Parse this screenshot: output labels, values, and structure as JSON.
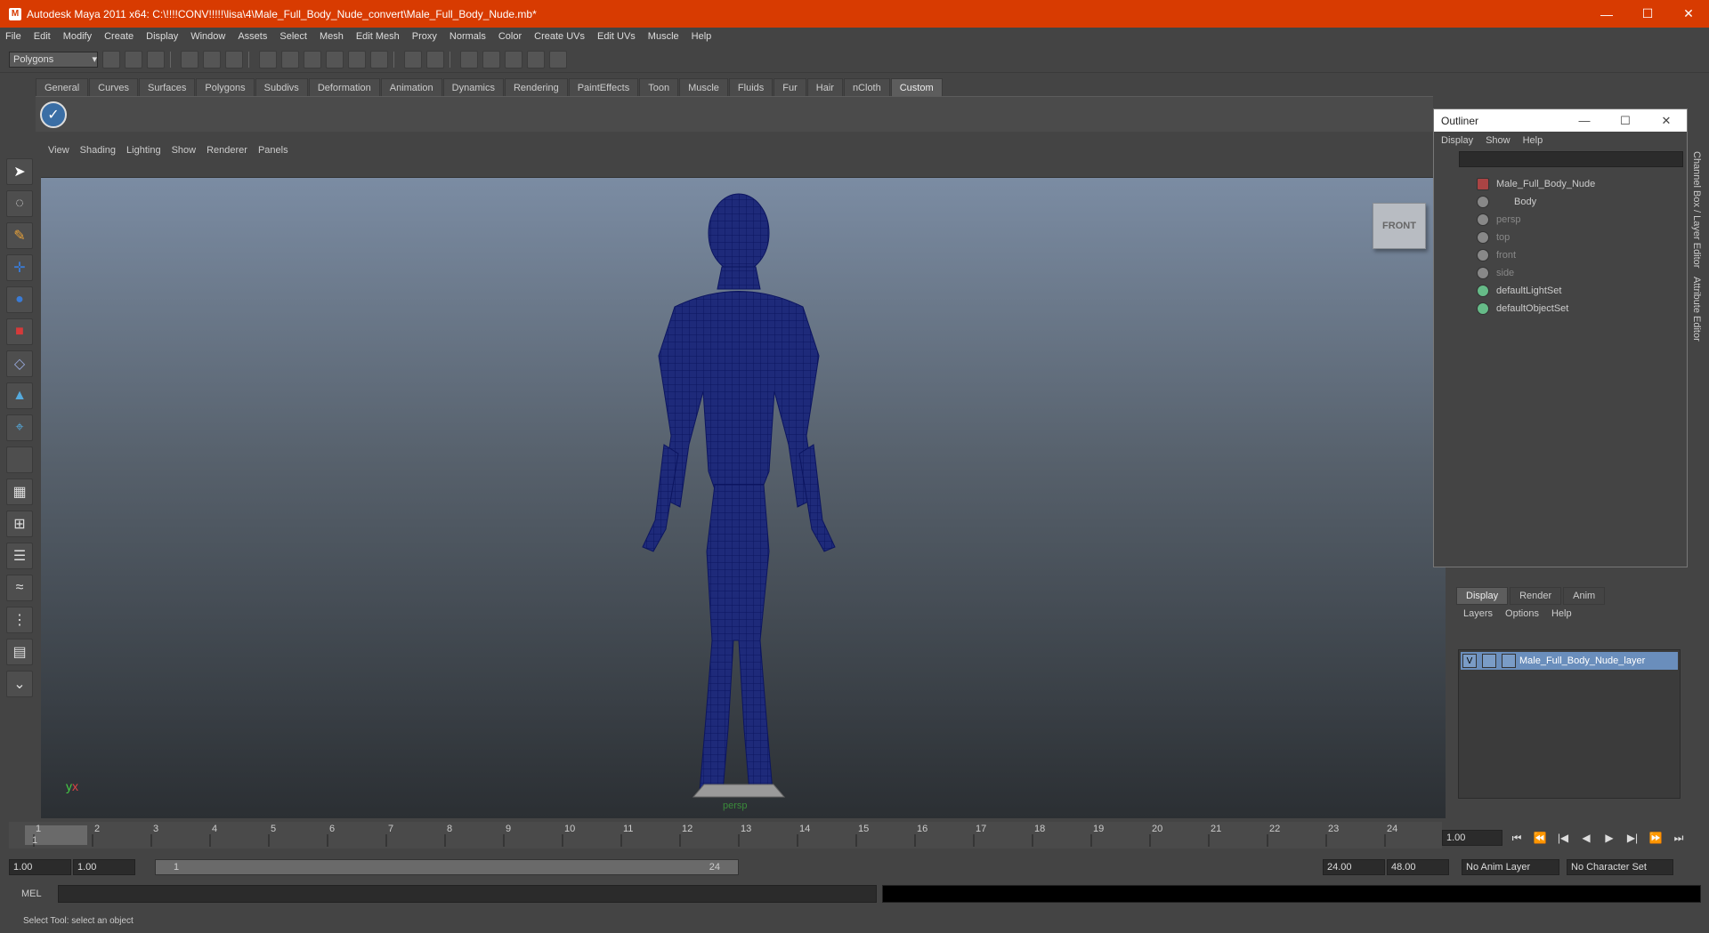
{
  "window": {
    "title": "Autodesk Maya 2011 x64: C:\\!!!!CONV!!!!!\\lisa\\4\\Male_Full_Body_Nude_convert\\Male_Full_Body_Nude.mb*",
    "minimize": "—",
    "maximize": "☐",
    "close": "✕"
  },
  "menu": [
    "File",
    "Edit",
    "Modify",
    "Create",
    "Display",
    "Window",
    "Assets",
    "Select",
    "Mesh",
    "Edit Mesh",
    "Proxy",
    "Normals",
    "Color",
    "Create UVs",
    "Edit UVs",
    "Muscle",
    "Help"
  ],
  "mode_select": "Polygons",
  "shelf_tabs": [
    "General",
    "Curves",
    "Surfaces",
    "Polygons",
    "Subdivs",
    "Deformation",
    "Animation",
    "Dynamics",
    "Rendering",
    "PaintEffects",
    "Toon",
    "Muscle",
    "Fluids",
    "Fur",
    "Hair",
    "nCloth",
    "Custom"
  ],
  "active_shelf": "Custom",
  "viewport_menu": [
    "View",
    "Shading",
    "Lighting",
    "Show",
    "Renderer",
    "Panels"
  ],
  "viewcube": "FRONT",
  "camera_label": "persp",
  "axis_labels": {
    "y": "y",
    "x": "x"
  },
  "outliner": {
    "title": "Outliner",
    "menu": [
      "Display",
      "Show",
      "Help"
    ],
    "items": [
      {
        "label": "Male_Full_Body_Nude",
        "dim": false,
        "indent": 0
      },
      {
        "label": "Body",
        "dim": false,
        "indent": 1
      },
      {
        "label": "persp",
        "dim": true,
        "indent": 0
      },
      {
        "label": "top",
        "dim": true,
        "indent": 0
      },
      {
        "label": "front",
        "dim": true,
        "indent": 0
      },
      {
        "label": "side",
        "dim": true,
        "indent": 0
      },
      {
        "label": "defaultLightSet",
        "dim": false,
        "indent": 0
      },
      {
        "label": "defaultObjectSet",
        "dim": false,
        "indent": 0
      }
    ]
  },
  "side_tabs": [
    "Channel Box / Layer Editor",
    "Attribute Editor"
  ],
  "layer_editor": {
    "tabs": [
      "Display",
      "Render",
      "Anim"
    ],
    "menu": [
      "Layers",
      "Options",
      "Help"
    ],
    "layer": {
      "visible": "V",
      "name": "Male_Full_Body_Nude_layer"
    }
  },
  "timeline": {
    "ticks": [
      "1",
      "2",
      "3",
      "4",
      "5",
      "6",
      "7",
      "8",
      "9",
      "10",
      "11",
      "12",
      "13",
      "14",
      "15",
      "16",
      "17",
      "18",
      "19",
      "20",
      "21",
      "22",
      "23",
      "24"
    ],
    "current": "1",
    "current_field": "1.00"
  },
  "playback": {
    "buttons": [
      "⏮",
      "⏪",
      "|◀",
      "◀",
      "▶",
      "▶|",
      "⏩",
      "⏭"
    ]
  },
  "range": {
    "start": "1.00",
    "start2": "1.00",
    "slider_start": "1",
    "slider_end": "24",
    "end": "24.00",
    "end2": "48.00",
    "anim_layer": "No Anim Layer",
    "char_set": "No Character Set"
  },
  "mel_label": "MEL",
  "status": "Select Tool: select an object"
}
